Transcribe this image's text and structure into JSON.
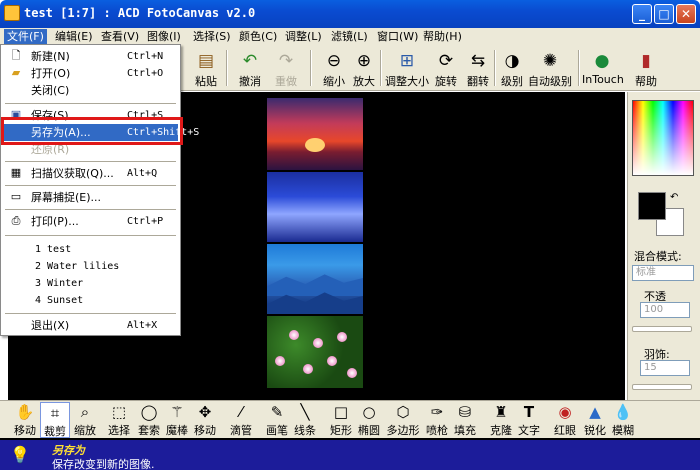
{
  "window": {
    "title": "test [1:7] : ACD FotoCanvas v2.0",
    "minimize": "_",
    "maximize": "□",
    "close": "✕"
  },
  "menubar": [
    "文件(F)",
    "编辑(E)",
    "查看(V)",
    "图像(I)",
    "选择(S)",
    "颜色(C)",
    "调整(L)",
    "滤镜(L)",
    "窗口(W)",
    "帮助(H)"
  ],
  "toolbar": {
    "buttons": [
      {
        "label": "粘贴",
        "icon": "paste-icon"
      },
      {
        "label": "撤消",
        "icon": "undo-icon"
      },
      {
        "label": "重做",
        "icon": "redo-icon"
      },
      {
        "label": "缩小",
        "icon": "zoom-out-icon"
      },
      {
        "label": "放大",
        "icon": "zoom-in-icon"
      },
      {
        "label": "调整大小",
        "icon": "resize-icon"
      },
      {
        "label": "旋转",
        "icon": "rotate-icon"
      },
      {
        "label": "翻转",
        "icon": "flip-icon"
      },
      {
        "label": "级别",
        "icon": "levels-icon"
      },
      {
        "label": "自动级别",
        "icon": "auto-levels-icon"
      },
      {
        "label": "InTouch",
        "icon": "intouch-icon"
      },
      {
        "label": "帮助",
        "icon": "help-book-icon"
      }
    ]
  },
  "file_menu": {
    "items": [
      {
        "label": "新建(N)",
        "shortcut": "Ctrl+N"
      },
      {
        "label": "打开(O)",
        "shortcut": "Ctrl+O"
      },
      {
        "label": "关闭(C)",
        "shortcut": ""
      },
      {
        "label": "保存(S)",
        "shortcut": "Ctrl+S"
      },
      {
        "label": "另存为(A)...",
        "shortcut": "Ctrl+Shift+S"
      },
      {
        "label": "还原(R)",
        "shortcut": ""
      },
      {
        "label": "扫描仪获取(Q)...",
        "shortcut": "Alt+Q"
      },
      {
        "label": "屏幕捕捉(E)...",
        "shortcut": ""
      },
      {
        "label": "打印(P)...",
        "shortcut": "Ctrl+P"
      },
      {
        "label": "退出(X)",
        "shortcut": "Alt+X"
      }
    ],
    "recent": [
      "1 test",
      "2 Water lilies",
      "3 Winter",
      "4 Sunset"
    ]
  },
  "right_panel": {
    "blend_label": "混合模式:",
    "blend_value": "标准",
    "opacity_label": "不透",
    "opacity_value": "100",
    "feather_label": "羽饰:",
    "feather_value": "15"
  },
  "bottom_tools": [
    {
      "label": "移动",
      "icon": "hand-icon"
    },
    {
      "label": "裁剪",
      "icon": "crop-icon"
    },
    {
      "label": "缩放",
      "icon": "zoom-icon"
    },
    {
      "label": "选择",
      "icon": "select-rect-icon"
    },
    {
      "label": "套索",
      "icon": "lasso-icon"
    },
    {
      "label": "魔棒",
      "icon": "magic-wand-icon"
    },
    {
      "label": "移动",
      "icon": "move-arrows-icon"
    },
    {
      "label": "滴管",
      "icon": "eyedropper-icon"
    },
    {
      "label": "画笔",
      "icon": "brush-icon"
    },
    {
      "label": "线条",
      "icon": "line-icon"
    },
    {
      "label": "矩形",
      "icon": "rectangle-icon"
    },
    {
      "label": "椭圆",
      "icon": "ellipse-icon"
    },
    {
      "label": "多边形",
      "icon": "polygon-icon"
    },
    {
      "label": "喷枪",
      "icon": "airbrush-icon"
    },
    {
      "label": "填充",
      "icon": "fill-bucket-icon"
    },
    {
      "label": "克隆",
      "icon": "clone-stamp-icon"
    },
    {
      "label": "文字",
      "icon": "text-tool-icon"
    },
    {
      "label": "红眼",
      "icon": "red-eye-icon"
    },
    {
      "label": "锐化",
      "icon": "sharpen-icon"
    },
    {
      "label": "模糊",
      "icon": "blur-icon"
    }
  ],
  "status": {
    "title": "另存为",
    "desc": "保存改变到新的图像."
  },
  "colors": {
    "highlight": "#316ac5",
    "annotation": "#e01818",
    "status_bg": "#1c1c9a"
  }
}
